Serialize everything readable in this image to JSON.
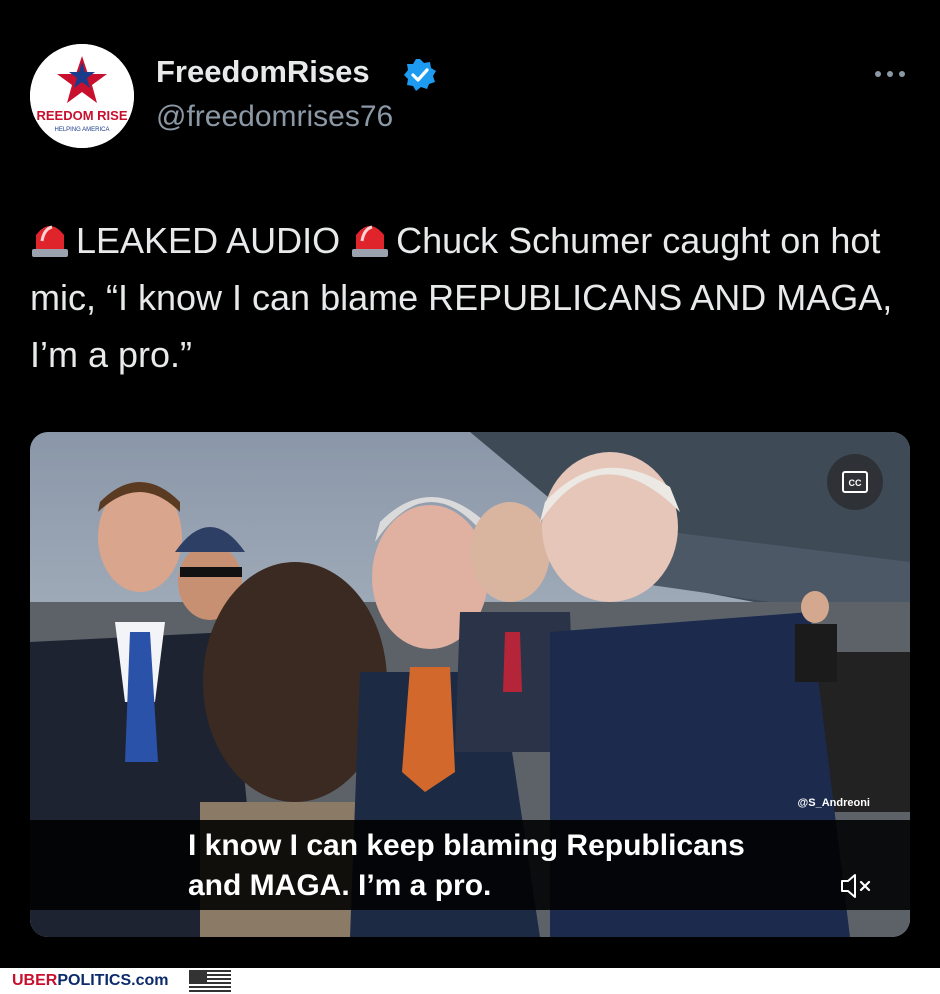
{
  "author": {
    "display_name": "FreedomRises",
    "handle": "@freedomrises76",
    "avatar_text": "REEDOM RISE",
    "avatar_subtext": "HELPING AMERICA"
  },
  "tweet": {
    "alert_label": "LEAKED AUDIO",
    "text_part1": "Chuck Schumer caught on hot mic, “I know I can blame REPUBLICANS AND MAGA, I’m a pro.”"
  },
  "media": {
    "caption_line1": "I know I can keep blaming Republicans",
    "caption_line2": "and MAGA. I’m a pro.",
    "credit": "@S_Andreoni",
    "cc_icon": "closed-captions-icon",
    "mute_icon": "speaker-muted-icon"
  },
  "footer": {
    "brand_part1": "UBER",
    "brand_part2": "POLITICS.com"
  },
  "colors": {
    "background": "#000000",
    "text_primary": "#e7e9ea",
    "text_secondary": "#8b98a5",
    "verified_blue": "#1d9bf0",
    "footer_red": "#c8102e",
    "footer_blue": "#0b2b6b"
  }
}
